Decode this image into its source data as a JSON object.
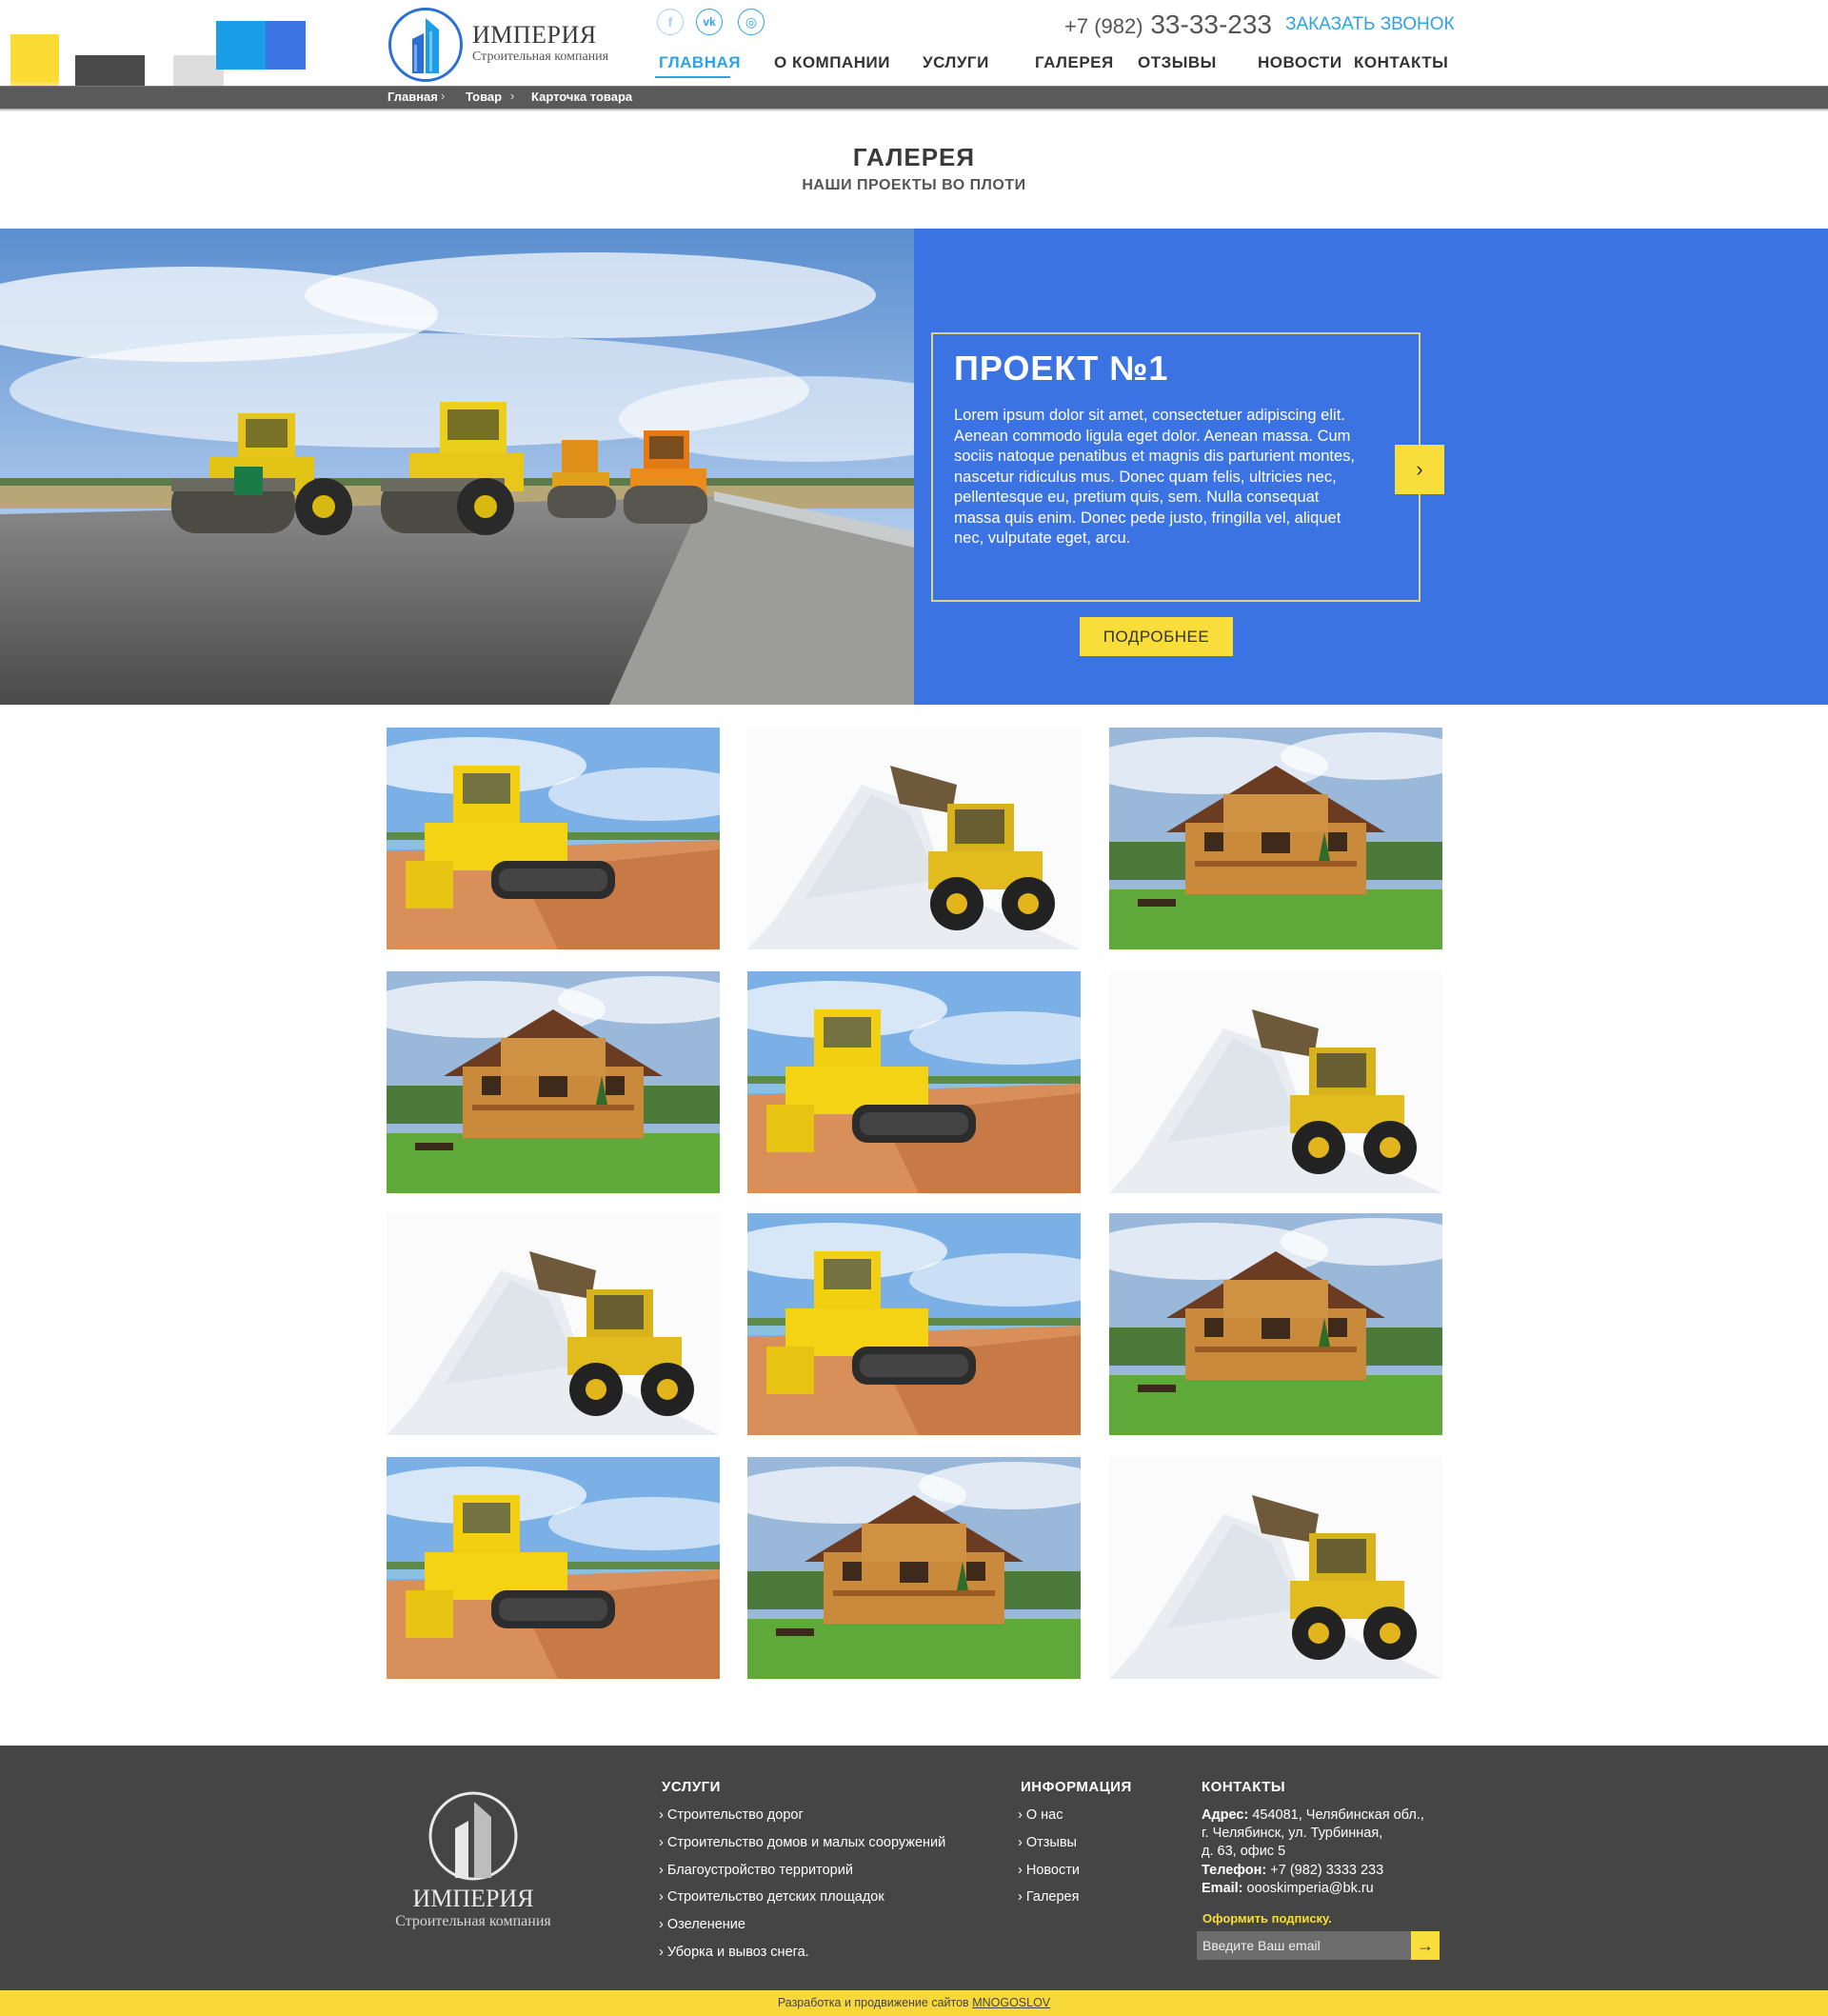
{
  "palette": [
    "#fddb35",
    "#4a4a4a",
    "#dddddd",
    "#1b9de8",
    "#3c73e3"
  ],
  "logo": {
    "title": "ИМПЕРИЯ",
    "subtitle": "Строительная компания"
  },
  "social": [
    {
      "name": "facebook",
      "glyph": "f"
    },
    {
      "name": "vk",
      "glyph": "vk"
    },
    {
      "name": "instagram",
      "glyph": "◎"
    }
  ],
  "header": {
    "phone_prefix": "+7 (982)",
    "phone_number": "33-33-233",
    "callback_label": "ЗАКАЗАТЬ ЗВОНОК"
  },
  "nav": [
    "ГЛАВНАЯ",
    "О КОМПАНИИ",
    "УСЛУГИ",
    "ГАЛЕРЕЯ",
    "ОТЗЫВЫ",
    "НОВОСТИ",
    "КОНТАКТЫ"
  ],
  "nav_active_index": 0,
  "breadcrumb": [
    "Главная",
    "Товар",
    "Карточка товара"
  ],
  "section": {
    "title": "ГАЛЕРЕЯ",
    "subtitle": "НАШИ ПРОЕКТЫ ВО ПЛОТИ"
  },
  "project": {
    "title": "ПРОЕКТ №1",
    "text": "Lorem ipsum dolor sit amet, consectetuer adipiscing elit. Aenean commodo ligula eget dolor. Aenean massa. Cum sociis natoque penatibus et magnis dis parturient montes, nascetur ridiculus mus. Donec quam felis, ultricies nec, pellentesque eu, pretium quis, sem. Nulla consequat massa quis enim. Donec pede justo, fringilla vel, aliquet nec, vulputate eget, arcu.",
    "more_label": "ПОДРОБНЕЕ"
  },
  "gallery": [
    "bulldozer",
    "snow-loader",
    "wooden-house",
    "wooden-house",
    "bulldozer",
    "snow-loader",
    "snow-loader",
    "bulldozer",
    "wooden-house",
    "bulldozer",
    "wooden-house",
    "snow-loader"
  ],
  "footer": {
    "logo_title": "ИМПЕРИЯ",
    "logo_subtitle": "Строительная компания",
    "services_title": "УСЛУГИ",
    "services": [
      "Строительство дорог",
      "Строительство домов и малых сооружений",
      "Благоустройство территорий",
      "Строительство детских площадок",
      " Озеленение",
      " Уборка и вывоз снега."
    ],
    "info_title": "ИНФОРМАЦИЯ",
    "info": [
      "О нас",
      "Отзывы",
      "Новости",
      "Галерея"
    ],
    "contacts_title": "КОНТАКТЫ",
    "address_label": "Адрес:",
    "address_line1": "454081, Челябинская обл.,",
    "address_line2": "г. Челябинск, ул. Турбинная,",
    "address_line3": "д. 63, офис 5",
    "phone_label": "Телефон:",
    "phone": "+7 (982) 3333 233",
    "email_label": "Email:",
    "email": "oooskimperia@bk.ru",
    "subscribe_label": "Оформить подписку.",
    "email_placeholder": "Введите Ваш email"
  },
  "bottom": {
    "text": "Разработка и продвижение сайтов",
    "link": "MNOGOSLOV"
  }
}
